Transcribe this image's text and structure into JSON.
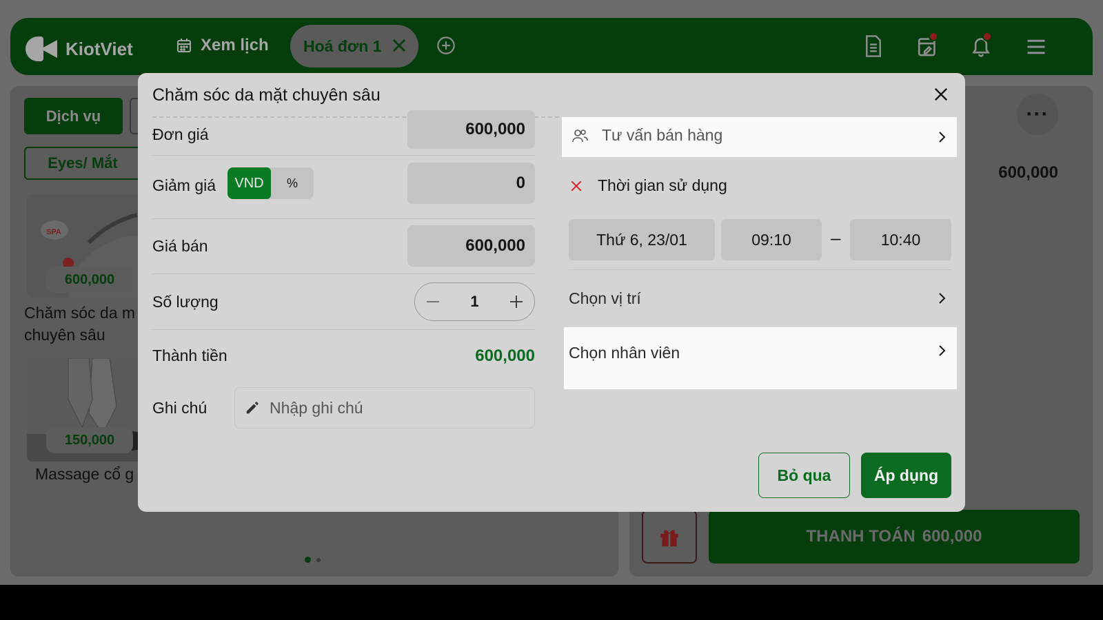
{
  "topbar": {
    "logo_text": "KiotViet",
    "schedule_label": "Xem lịch",
    "active_tab_label": "Hoá đơn 1"
  },
  "left_panel": {
    "category_label": "Dịch vụ",
    "subcategory_label": "Eyes/ Mắt",
    "products": [
      {
        "price": "600,000",
        "name_line1": "Chăm sóc da m",
        "name_line2": "chuyên sâu",
        "image_text": "SPA"
      },
      {
        "price": "150,000",
        "name_line1": "Massage cổ g"
      }
    ]
  },
  "right_panel": {
    "line_price": "600,000",
    "pay_label": "THANH TOÁN",
    "pay_amount": "600,000"
  },
  "modal": {
    "title": "Chăm sóc da mặt chuyên sâu",
    "unit_price_label": "Đơn giá",
    "unit_price_value": "600,000",
    "discount_label": "Giảm giá",
    "discount_unit_vnd": "VND",
    "discount_unit_percent": "%",
    "discount_value": "0",
    "sale_price_label": "Giá bán",
    "sale_price_value": "600,000",
    "quantity_label": "Số lượng",
    "quantity_value": "1",
    "total_label": "Thành tiền",
    "total_value": "600,000",
    "note_label": "Ghi chú",
    "note_placeholder": "Nhập ghi chú",
    "sales_consultant_label": "Tư vấn bán hàng",
    "usage_time_label": "Thời gian sử dụng",
    "date_value": "Thứ 6, 23/01",
    "start_time": "09:10",
    "time_separator": "–",
    "end_time": "10:40",
    "location_label": "Chọn vị trí",
    "staff_label": "Chọn nhân viên",
    "cancel_label": "Bỏ qua",
    "apply_label": "Áp dụng"
  },
  "colors": {
    "brand_green": "#0b6b20",
    "topbar_green": "#063d0d",
    "accent_red": "#d9262b"
  }
}
